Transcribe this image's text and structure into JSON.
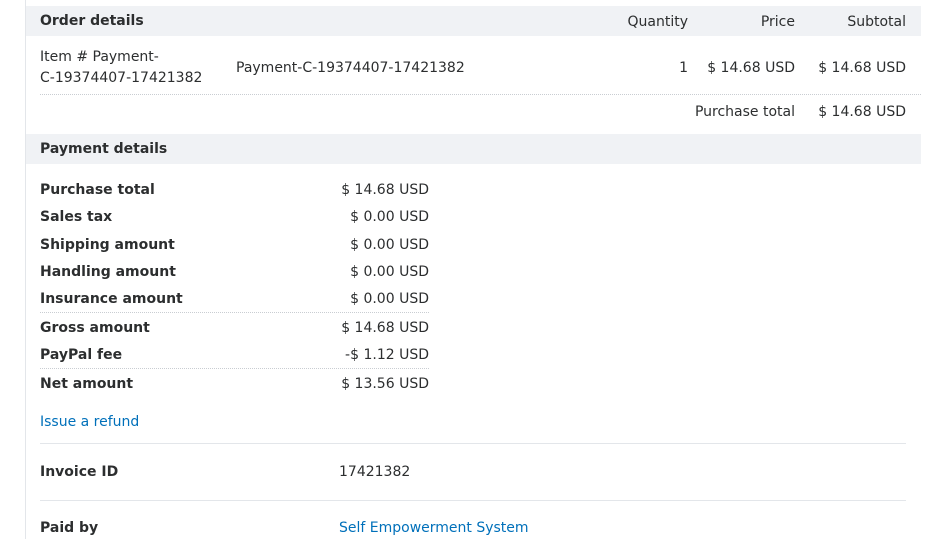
{
  "order": {
    "title": "Order details",
    "columns": {
      "quantity": "Quantity",
      "price": "Price",
      "subtotal": "Subtotal"
    },
    "item": {
      "name_line1": "Item # Payment-",
      "name_line2": "C-19374407-17421382",
      "description": "Payment-C-19374407-17421382",
      "quantity": "1",
      "price": "$ 14.68 USD",
      "subtotal": "$ 14.68 USD"
    },
    "purchase_total_label": "Purchase total",
    "purchase_total_value": "$ 14.68 USD"
  },
  "payment": {
    "title": "Payment details",
    "rows": [
      {
        "label": "Purchase total",
        "value": "$ 14.68 USD"
      },
      {
        "label": "Sales tax",
        "value": "$ 0.00 USD"
      },
      {
        "label": "Shipping amount",
        "value": "$ 0.00 USD"
      },
      {
        "label": "Handling amount",
        "value": "$ 0.00 USD"
      },
      {
        "label": "Insurance amount",
        "value": "$ 0.00 USD"
      },
      {
        "label": "Gross amount",
        "value": "$ 14.68 USD"
      },
      {
        "label": "PayPal fee",
        "value": "-$ 1.12 USD"
      },
      {
        "label": "Net amount",
        "value": "$ 13.56 USD"
      }
    ],
    "refund_link": "Issue a refund",
    "invoice_label": "Invoice ID",
    "invoice_value": "17421382",
    "paid_by_label": "Paid by",
    "paid_by_value": "Self Empowerment System"
  }
}
